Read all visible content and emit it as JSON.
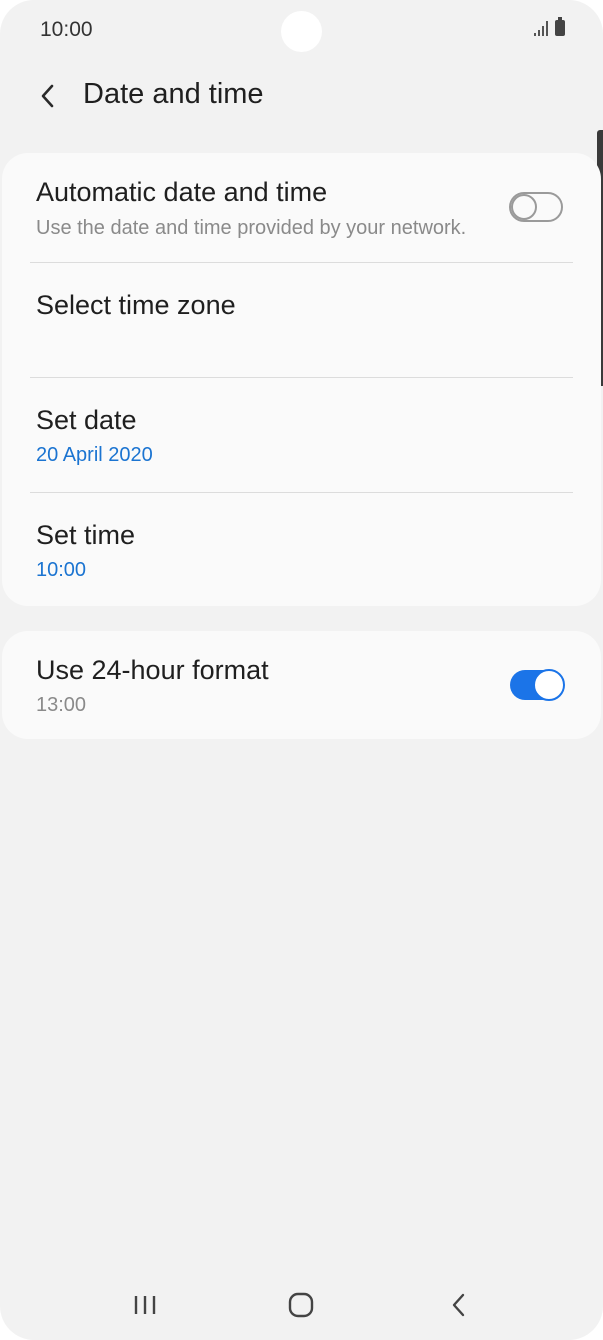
{
  "status_bar": {
    "time": "10:00",
    "signal_icon": "signal-icon",
    "battery_icon": "battery-icon"
  },
  "header": {
    "title": "Date and time",
    "back_icon": "chevron-left-icon"
  },
  "settings": {
    "automatic_date_time": {
      "title": "Automatic date and time",
      "subtitle": "Use the date and time provided by your network.",
      "enabled": false
    },
    "time_zone": {
      "title": "Select time zone"
    },
    "set_date": {
      "title": "Set date",
      "value": "20 April 2020"
    },
    "set_time": {
      "title": "Set time",
      "value": "10:00"
    },
    "hour_format_24": {
      "title": "Use 24-hour format",
      "subtitle": "13:00",
      "enabled": true
    }
  },
  "nav_bar": {
    "recents_icon": "recents-icon",
    "home_icon": "home-icon",
    "back_icon": "back-icon"
  },
  "colors": {
    "accent": "#1b74e8",
    "link_blue": "#1b74d1",
    "background": "#f2f2f2",
    "card": "#fafafa"
  }
}
